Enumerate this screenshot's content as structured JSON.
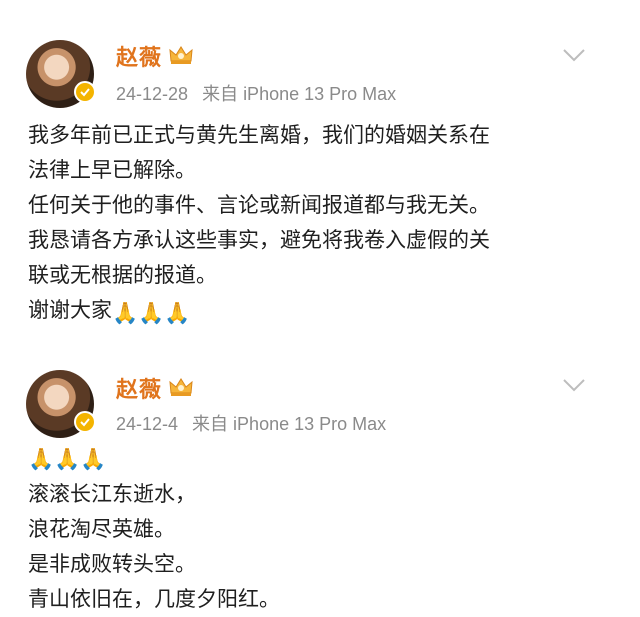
{
  "posts": [
    {
      "author": "赵薇",
      "date": "24-12-28",
      "source": "来自 iPhone 13 Pro Max",
      "lines": [
        "我多年前已正式与黄先生离婚，我们的婚姻关系在",
        "法律上早已解除。",
        "任何关于他的事件、言论或新闻报道都与我无关。",
        "我恳请各方承认这些事实，避免将我卷入虚假的关",
        "联或无根据的报道。",
        "谢谢大家"
      ],
      "emoji_after_last_line": "🙏🙏🙏"
    },
    {
      "author": "赵薇",
      "date": "24-12-4",
      "source": "来自 iPhone 13 Pro Max",
      "emoji_first_line": "🙏🙏🙏",
      "lines": [
        "滚滚长江东逝水，",
        "浪花淘尽英雄。",
        "是非成败转头空。",
        "青山依旧在，几度夕阳红。"
      ]
    }
  ],
  "colors": {
    "name": "#e0741d",
    "meta": "#8a8a8a",
    "badge": "#f4b400"
  },
  "icons": {
    "verified": "verified-badge-icon",
    "member": "crown-icon",
    "more": "chevron-down-icon",
    "emoji": "folded-hands-icon"
  }
}
